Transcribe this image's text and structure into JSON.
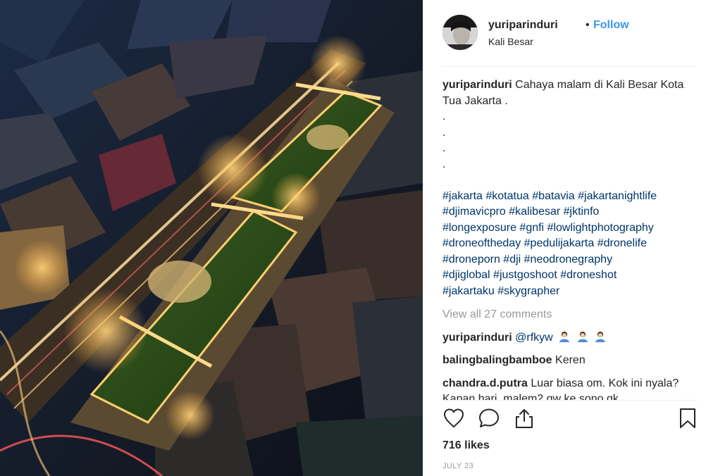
{
  "post": {
    "username": "yuriparinduri",
    "separator": "•",
    "follow_label": "Follow",
    "location": "Kali Besar"
  },
  "caption": {
    "username": "yuriparinduri",
    "text": "Cahaya malam di Kali Besar Kota Tua Jakarta .",
    "dots": [
      ".",
      ".",
      ".",
      "."
    ],
    "hashtag_lines": [
      "#jakarta #kotatua #batavia #jakartanightlife",
      "#djimavicpro #kalibesar #jktinfo",
      "#longexposure #gnfi #lowlightphotography",
      "#droneoftheday #pedulijakarta #dronelife",
      "#droneporn #dji #neodronegraphy",
      "#djiglobal #justgoshoot #droneshot",
      "#jakartaku #skygrapher"
    ]
  },
  "view_all_comments": "View all 27 comments",
  "comments": [
    {
      "username": "yuriparinduri",
      "mention": "@rfkyw",
      "emoji_icon": "person-tipping-hand-emoji x3"
    },
    {
      "username": "balingbalingbamboe",
      "text": "Keren"
    },
    {
      "username": "chandra.d.putra",
      "text": "Luar biasa om. Kok ini nyala? Kapan hari, malem2 gw ke sono gk"
    }
  ],
  "actions": {
    "like_icon": "heart-icon",
    "comment_icon": "comment-bubble-icon",
    "share_icon": "share-upload-icon",
    "save_icon": "bookmark-icon"
  },
  "likes": "716 likes",
  "date": "JULY 23",
  "colors": {
    "link_blue": "#3897f0",
    "hashtag_navy": "#003569",
    "muted_gray": "#999999",
    "text": "#262626"
  }
}
